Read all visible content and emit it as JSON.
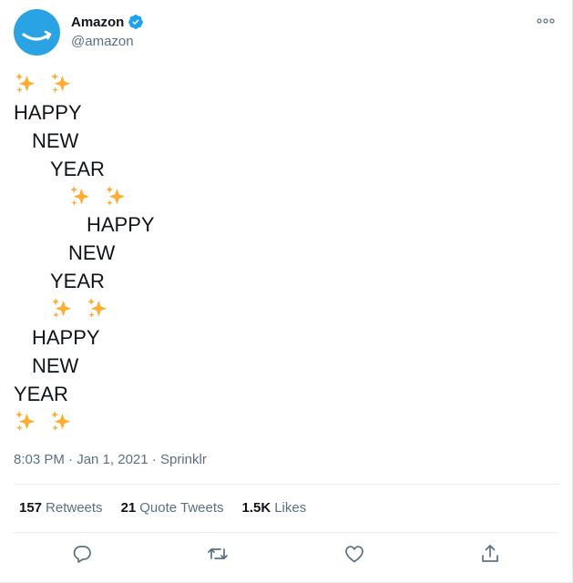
{
  "user": {
    "display_name": "Amazon",
    "handle": "@amazon",
    "verified": true,
    "avatar_icon": "amazon-smile-logo",
    "avatar_color": "#2aa3e5"
  },
  "tweet": {
    "lines": [
      {
        "text": "",
        "sparkles": true,
        "indent": 0
      },
      {
        "text": "HAPPY",
        "sparkles": false,
        "indent": 0
      },
      {
        "text": "NEW",
        "sparkles": false,
        "indent": 1
      },
      {
        "text": "YEAR",
        "sparkles": false,
        "indent": 2
      },
      {
        "text": "",
        "sparkles": true,
        "indent": 3
      },
      {
        "text": "HAPPY",
        "sparkles": false,
        "indent": 4
      },
      {
        "text": "NEW",
        "sparkles": false,
        "indent": 3
      },
      {
        "text": "YEAR",
        "sparkles": false,
        "indent": 2
      },
      {
        "text": "",
        "sparkles": true,
        "indent": 2
      },
      {
        "text": "HAPPY",
        "sparkles": false,
        "indent": 1
      },
      {
        "text": "NEW",
        "sparkles": false,
        "indent": 1
      },
      {
        "text": "YEAR",
        "sparkles": false,
        "indent": 0
      },
      {
        "text": "",
        "sparkles": true,
        "indent": 0
      }
    ]
  },
  "meta": {
    "time": "8:03 PM",
    "separator": " · ",
    "date": "Jan 1, 2021",
    "source": "Sprinklr"
  },
  "stats": {
    "retweets_count": "157",
    "retweets_label": "Retweets",
    "quotes_count": "21",
    "quotes_label": "Quote Tweets",
    "likes_count": "1.5K",
    "likes_label": "Likes"
  },
  "actions": [
    "reply-icon",
    "retweet-icon",
    "like-icon",
    "share-icon"
  ],
  "colors": {
    "text": "#0f1419",
    "secondary": "#5b7083",
    "verified": "#1da1f2",
    "sparkle": "#ffac33",
    "divider": "#e6ecf0"
  }
}
